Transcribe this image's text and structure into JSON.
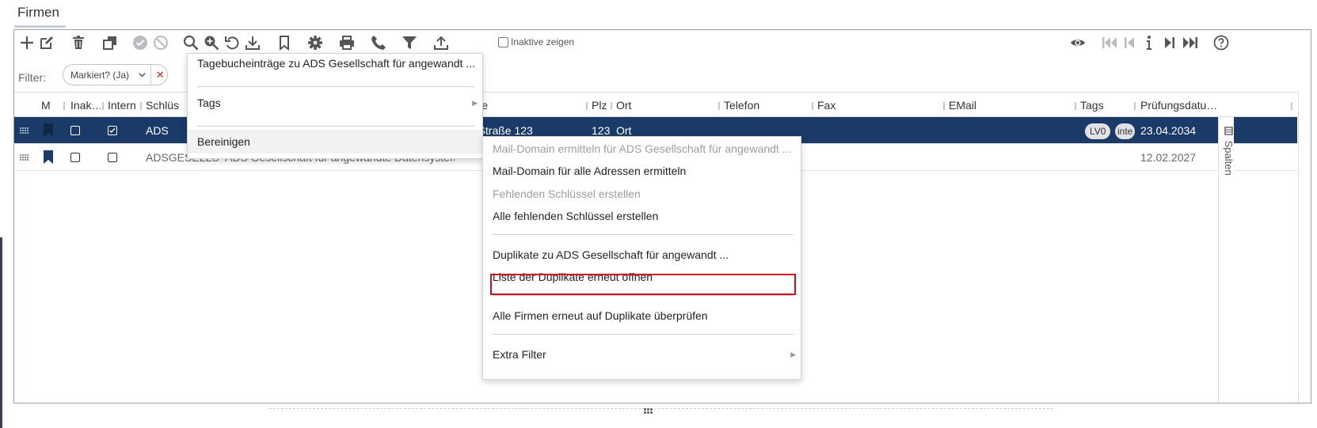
{
  "window": {
    "title": "Firmen"
  },
  "toolbar": {
    "inactive_label": "Inaktive zeigen",
    "icons_left": [
      "plus-icon",
      "edit-icon",
      "trash-icon",
      "copy-icon",
      "check-circle-icon",
      "ban-icon",
      "search-icon",
      "zoom-in-icon",
      "undo-icon",
      "download-icon",
      "bookmark-icon",
      "gear-icon",
      "print-icon",
      "phone-icon",
      "filter-icon",
      "upload-icon"
    ],
    "icons_right": [
      "eye-icon",
      "first-icon",
      "prev-icon",
      "info-icon",
      "next-icon",
      "last-icon",
      "help-icon"
    ]
  },
  "filter": {
    "label": "Filter:",
    "chip_text": "Markiert? (Ja)",
    "chip_remove": "✕"
  },
  "table": {
    "columns": [
      "M",
      "Inak…",
      "Intern",
      "Schlüs",
      "Straße",
      "Plz",
      "Ort",
      "Telefon",
      "Fax",
      "EMail",
      "Tags",
      "Prüfungsdatu…"
    ],
    "rows": [
      {
        "selected": true,
        "inaktiv": false,
        "intern": true,
        "schluessel": "ADS",
        "name": "",
        "strasse": "Test Straße 123",
        "plz": "123",
        "ort": "Ort",
        "tags": [
          "LV0",
          "inte"
        ],
        "pruefung": "23.04.2034"
      },
      {
        "selected": false,
        "inaktiv": false,
        "intern": false,
        "schluessel": "ADSGESELLS",
        "name": "ADS Gesellschaft für angewandte Datensysteme",
        "strasse": "",
        "plz": "",
        "ort": "",
        "tags": [],
        "pruefung": "12.02.2027"
      }
    ],
    "side_panel_label": "Spalten"
  },
  "context_menu": {
    "items": [
      {
        "label": "Tagebucheinträge zu ADS Gesellschaft für angewandt ..."
      },
      {
        "label": "Tags"
      },
      {
        "label": "Bereinigen"
      }
    ]
  },
  "submenu": {
    "items": [
      {
        "label": "Mail-Domain ermitteln für ADS Gesellschaft für angewandt ...",
        "disabled": true
      },
      {
        "label": "Mail-Domain für alle Adressen ermitteln",
        "disabled": false
      },
      {
        "label": "Fehlenden Schlüssel erstellen",
        "disabled": true
      },
      {
        "label": "Alle fehlenden Schlüssel erstellen",
        "disabled": false
      },
      {
        "label": "Duplikate zu ADS Gesellschaft für angewandt ...",
        "disabled": false
      },
      {
        "label": "Liste der Duplikate erneut öffnen",
        "disabled": false,
        "highlighted": true
      },
      {
        "label": "Alle Firmen erneut auf Duplikate überprüfen",
        "disabled": false
      },
      {
        "label": "Extra Filter",
        "disabled": false
      }
    ]
  },
  "colors": {
    "selected_row": "#1a3a67",
    "highlight_border": "#d0101c",
    "bookmark": "#1a3a67"
  }
}
